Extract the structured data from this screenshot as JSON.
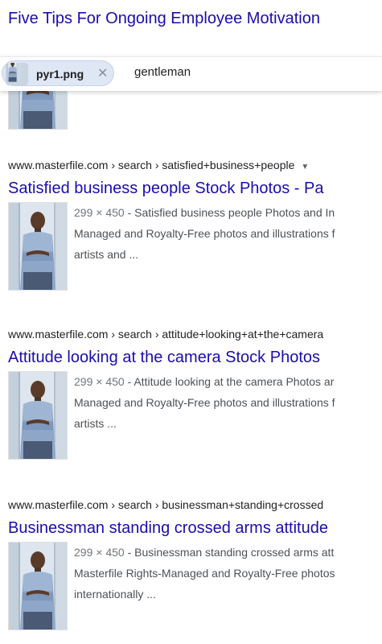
{
  "top_title": "Five Tips For Ongoing Employee Motivation",
  "search": {
    "chip_label": "pyr1.png",
    "chip_close": "✕",
    "query": "gentleman"
  },
  "results": [
    {
      "breadcrumb": "www.masterfile.com › search › satisfied+business+people",
      "caret": "▼",
      "title": "Satisfied business people Stock Photos - Pa",
      "dims": "299 × 450",
      "lines": [
        "- Satisfied business people Photos and In",
        "Managed and Royalty-Free photos and illustrations f",
        "artists and ..."
      ]
    },
    {
      "breadcrumb": "www.masterfile.com › search › attitude+looking+at+the+camera",
      "title": "Attitude looking at the camera Stock Photos",
      "dims": "299 × 450",
      "lines": [
        "- Attitude looking at the camera Photos ar",
        "Managed and Royalty-Free photos and illustrations f",
        "artists ..."
      ]
    },
    {
      "breadcrumb": "www.masterfile.com › search › businessman+standing+crossed",
      "title": "Businessman standing crossed arms attitude",
      "dims": "299 × 450",
      "lines": [
        "- Businessman standing crossed arms att",
        "Masterfile Rights-Managed and Royalty-Free photos",
        "internationally ..."
      ]
    }
  ]
}
